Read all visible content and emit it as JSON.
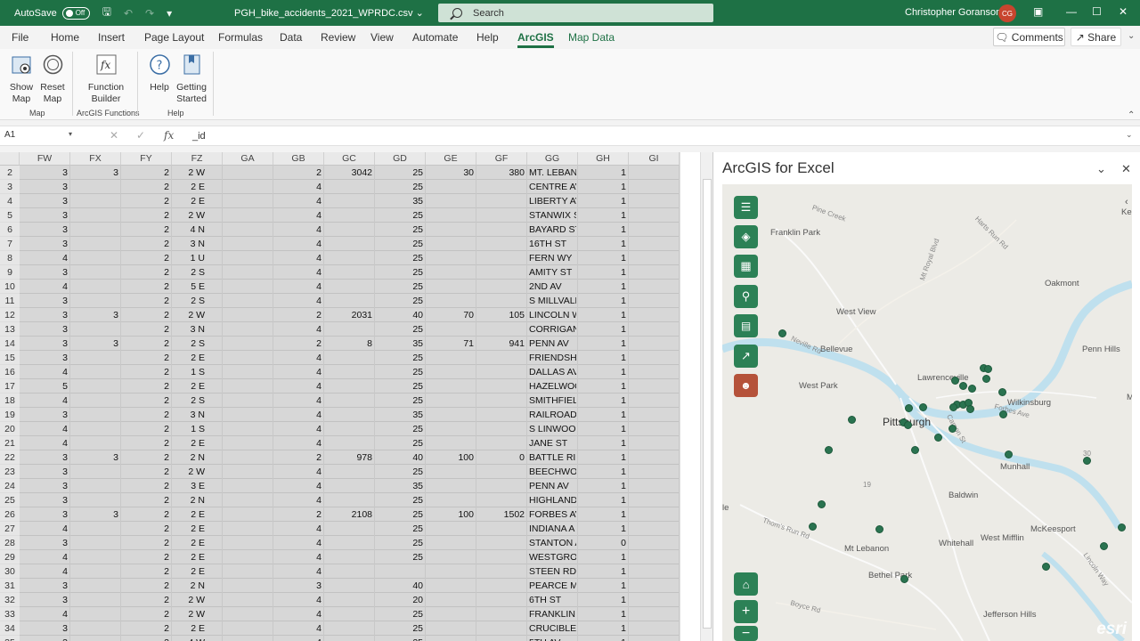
{
  "titlebar": {
    "autosave_label": "AutoSave",
    "autosave_state": "Off",
    "filename": "PGH_bike_accidents_2021_WPRDC.csv",
    "search_placeholder": "Search",
    "user_name": "Christopher Goranson",
    "user_initials": "CG"
  },
  "menu": {
    "tabs": [
      "File",
      "Home",
      "Insert",
      "Page Layout",
      "Formulas",
      "Data",
      "Review",
      "View",
      "Automate",
      "Help",
      "ArcGIS",
      "Map Data"
    ],
    "active_tab": "ArcGIS",
    "comments": "Comments",
    "share": "Share"
  },
  "ribbon": {
    "show_map": [
      "Show",
      "Map"
    ],
    "reset_map": [
      "Reset",
      "Map"
    ],
    "function_builder": [
      "Function",
      "Builder"
    ],
    "help": "Help",
    "getting_started": [
      "Getting",
      "Started"
    ],
    "groups": [
      "Map",
      "ArcGIS Functions",
      "Help"
    ]
  },
  "formula_bar": {
    "name_box": "A1",
    "fx": "fx",
    "value": "_id"
  },
  "sheet": {
    "columns": [
      "FW",
      "FX",
      "FY",
      "FZ",
      "GA",
      "GB",
      "GC",
      "GD",
      "GE",
      "GF",
      "GG",
      "GH",
      "GI"
    ],
    "rows": [
      {
        "n": "2",
        "FW": "3",
        "FX": "3",
        "FY": "2",
        "FZ": "2 W",
        "GB": "2",
        "GC": "3042",
        "GD": "25",
        "GE": "30",
        "GF": "380",
        "GG": "MT. LEBAN",
        "GH": "1"
      },
      {
        "n": "3",
        "FW": "3",
        "FX": "",
        "FY": "2",
        "FZ": "2 E",
        "GB": "4",
        "GC": "",
        "GD": "25",
        "GE": "",
        "GF": "",
        "GG": "CENTRE AV",
        "GH": "1"
      },
      {
        "n": "4",
        "FW": "3",
        "FX": "",
        "FY": "2",
        "FZ": "2 E",
        "GB": "4",
        "GC": "",
        "GD": "35",
        "GE": "",
        "GF": "",
        "GG": "LIBERTY AV",
        "GH": "1"
      },
      {
        "n": "5",
        "FW": "3",
        "FX": "",
        "FY": "2",
        "FZ": "2 W",
        "GB": "4",
        "GC": "",
        "GD": "25",
        "GE": "",
        "GF": "",
        "GG": "STANWIX S",
        "GH": "1"
      },
      {
        "n": "6",
        "FW": "3",
        "FX": "",
        "FY": "2",
        "FZ": "4 N",
        "GB": "4",
        "GC": "",
        "GD": "25",
        "GE": "",
        "GF": "",
        "GG": "BAYARD ST",
        "GH": "1"
      },
      {
        "n": "7",
        "FW": "3",
        "FX": "",
        "FY": "2",
        "FZ": "3 N",
        "GB": "4",
        "GC": "",
        "GD": "25",
        "GE": "",
        "GF": "",
        "GG": "16TH ST",
        "GH": "1"
      },
      {
        "n": "8",
        "FW": "4",
        "FX": "",
        "FY": "2",
        "FZ": "1 U",
        "GB": "4",
        "GC": "",
        "GD": "25",
        "GE": "",
        "GF": "",
        "GG": "FERN WY",
        "GH": "1"
      },
      {
        "n": "9",
        "FW": "3",
        "FX": "",
        "FY": "2",
        "FZ": "2 S",
        "GB": "4",
        "GC": "",
        "GD": "25",
        "GE": "",
        "GF": "",
        "GG": "AMITY ST",
        "GH": "1"
      },
      {
        "n": "10",
        "FW": "4",
        "FX": "",
        "FY": "2",
        "FZ": "5 E",
        "GB": "4",
        "GC": "",
        "GD": "25",
        "GE": "",
        "GF": "",
        "GG": "2ND AV",
        "GH": "1"
      },
      {
        "n": "11",
        "FW": "3",
        "FX": "",
        "FY": "2",
        "FZ": "2 S",
        "GB": "4",
        "GC": "",
        "GD": "25",
        "GE": "",
        "GF": "",
        "GG": "S MILLVALE",
        "GH": "1"
      },
      {
        "n": "12",
        "FW": "3",
        "FX": "3",
        "FY": "2",
        "FZ": "2 W",
        "GB": "2",
        "GC": "2031",
        "GD": "40",
        "GE": "70",
        "GF": "105",
        "GG": "LINCOLN W",
        "GH": "1"
      },
      {
        "n": "13",
        "FW": "3",
        "FX": "",
        "FY": "2",
        "FZ": "3 N",
        "GB": "4",
        "GC": "",
        "GD": "25",
        "GE": "",
        "GF": "",
        "GG": "CORRIGAN",
        "GH": "1"
      },
      {
        "n": "14",
        "FW": "3",
        "FX": "3",
        "FY": "2",
        "FZ": "2 S",
        "GB": "2",
        "GC": "8",
        "GD": "35",
        "GE": "71",
        "GF": "941",
        "GG": "PENN AV",
        "GH": "1"
      },
      {
        "n": "15",
        "FW": "3",
        "FX": "",
        "FY": "2",
        "FZ": "2 E",
        "GB": "4",
        "GC": "",
        "GD": "25",
        "GE": "",
        "GF": "",
        "GG": "FRIENDSHI",
        "GH": "1"
      },
      {
        "n": "16",
        "FW": "4",
        "FX": "",
        "FY": "2",
        "FZ": "1 S",
        "GB": "4",
        "GC": "",
        "GD": "25",
        "GE": "",
        "GF": "",
        "GG": "DALLAS AV",
        "GH": "1"
      },
      {
        "n": "17",
        "FW": "5",
        "FX": "",
        "FY": "2",
        "FZ": "2 E",
        "GB": "4",
        "GC": "",
        "GD": "25",
        "GE": "",
        "GF": "",
        "GG": "HAZELWOO",
        "GH": "1"
      },
      {
        "n": "18",
        "FW": "4",
        "FX": "",
        "FY": "2",
        "FZ": "2 S",
        "GB": "4",
        "GC": "",
        "GD": "25",
        "GE": "",
        "GF": "",
        "GG": "SMITHFIELI",
        "GH": "1"
      },
      {
        "n": "19",
        "FW": "3",
        "FX": "",
        "FY": "2",
        "FZ": "3 N",
        "GB": "4",
        "GC": "",
        "GD": "35",
        "GE": "",
        "GF": "",
        "GG": "RAILROAD",
        "GH": "1"
      },
      {
        "n": "20",
        "FW": "4",
        "FX": "",
        "FY": "2",
        "FZ": "1 S",
        "GB": "4",
        "GC": "",
        "GD": "25",
        "GE": "",
        "GF": "",
        "GG": "S LINWOOI",
        "GH": "1"
      },
      {
        "n": "21",
        "FW": "4",
        "FX": "",
        "FY": "2",
        "FZ": "2 E",
        "GB": "4",
        "GC": "",
        "GD": "25",
        "GE": "",
        "GF": "",
        "GG": "JANE ST",
        "GH": "1"
      },
      {
        "n": "22",
        "FW": "3",
        "FX": "3",
        "FY": "2",
        "FZ": "2 N",
        "GB": "2",
        "GC": "978",
        "GD": "40",
        "GE": "100",
        "GF": "0",
        "GG": "BATTLE RID",
        "GH": "1"
      },
      {
        "n": "23",
        "FW": "3",
        "FX": "",
        "FY": "2",
        "FZ": "2 W",
        "GB": "4",
        "GC": "",
        "GD": "25",
        "GE": "",
        "GF": "",
        "GG": "BEECHWOC",
        "GH": "1"
      },
      {
        "n": "24",
        "FW": "3",
        "FX": "",
        "FY": "2",
        "FZ": "3 E",
        "GB": "4",
        "GC": "",
        "GD": "35",
        "GE": "",
        "GF": "",
        "GG": "PENN AV",
        "GH": "1"
      },
      {
        "n": "25",
        "FW": "3",
        "FX": "",
        "FY": "2",
        "FZ": "2 N",
        "GB": "4",
        "GC": "",
        "GD": "25",
        "GE": "",
        "GF": "",
        "GG": "HIGHLAND",
        "GH": "1"
      },
      {
        "n": "26",
        "FW": "3",
        "FX": "3",
        "FY": "2",
        "FZ": "2 E",
        "GB": "2",
        "GC": "2108",
        "GD": "25",
        "GE": "100",
        "GF": "1502",
        "GG": "FORBES AV",
        "GH": "1"
      },
      {
        "n": "27",
        "FW": "4",
        "FX": "",
        "FY": "2",
        "FZ": "2 E",
        "GB": "4",
        "GC": "",
        "GD": "25",
        "GE": "",
        "GF": "",
        "GG": "INDIANA A",
        "GH": "1"
      },
      {
        "n": "28",
        "FW": "3",
        "FX": "",
        "FY": "2",
        "FZ": "2 E",
        "GB": "4",
        "GC": "",
        "GD": "25",
        "GE": "",
        "GF": "",
        "GG": "STANTON A",
        "GH": "0"
      },
      {
        "n": "29",
        "FW": "4",
        "FX": "",
        "FY": "2",
        "FZ": "2 E",
        "GB": "4",
        "GC": "",
        "GD": "25",
        "GE": "",
        "GF": "",
        "GG": "WESTGROV",
        "GH": "1"
      },
      {
        "n": "30",
        "FW": "4",
        "FX": "",
        "FY": "2",
        "FZ": "2 E",
        "GB": "4",
        "GC": "",
        "GD": "",
        "GE": "",
        "GF": "",
        "GG": "STEEN RD",
        "GH": "1"
      },
      {
        "n": "31",
        "FW": "3",
        "FX": "",
        "FY": "2",
        "FZ": "2 N",
        "GB": "3",
        "GC": "",
        "GD": "40",
        "GE": "",
        "GF": "",
        "GG": "PEARCE MI",
        "GH": "1"
      },
      {
        "n": "32",
        "FW": "3",
        "FX": "",
        "FY": "2",
        "FZ": "2 W",
        "GB": "4",
        "GC": "",
        "GD": "20",
        "GE": "",
        "GF": "",
        "GG": "6TH ST",
        "GH": "1"
      },
      {
        "n": "33",
        "FW": "4",
        "FX": "",
        "FY": "2",
        "FZ": "2 W",
        "GB": "4",
        "GC": "",
        "GD": "25",
        "GE": "",
        "GF": "",
        "GG": "FRANKLIN S",
        "GH": "1"
      },
      {
        "n": "34",
        "FW": "3",
        "FX": "",
        "FY": "2",
        "FZ": "2 E",
        "GB": "4",
        "GC": "",
        "GD": "25",
        "GE": "",
        "GF": "",
        "GG": "CRUCIBLE S",
        "GH": "1"
      },
      {
        "n": "35",
        "FW": "3",
        "FX": "",
        "FY": "2",
        "FZ": "4 W",
        "GB": "4",
        "GC": "",
        "GD": "25",
        "GE": "",
        "GF": "",
        "GG": "5TH AV",
        "GH": "1"
      }
    ]
  },
  "pane": {
    "title": "ArcGIS for Excel",
    "map_labels": [
      {
        "t": "Franklin Park",
        "cls": ""
      },
      {
        "t": "Oakmont",
        "cls": ""
      },
      {
        "t": "West View",
        "cls": ""
      },
      {
        "t": "Bellevue",
        "cls": ""
      },
      {
        "t": "Penn Hills",
        "cls": ""
      },
      {
        "t": "West Park",
        "cls": ""
      },
      {
        "t": "Lawrenceville",
        "cls": ""
      },
      {
        "t": "Wilkinsburg",
        "cls": ""
      },
      {
        "t": "Pittsburgh",
        "cls": "big"
      },
      {
        "t": "Munhall",
        "cls": ""
      },
      {
        "t": "Baldwin",
        "cls": ""
      },
      {
        "t": "McKeesport",
        "cls": ""
      },
      {
        "t": "Whitehall",
        "cls": ""
      },
      {
        "t": "West Mifflin",
        "cls": ""
      },
      {
        "t": "Mt Lebanon",
        "cls": ""
      },
      {
        "t": "Bethel Park",
        "cls": ""
      },
      {
        "t": "Jefferson Hills",
        "cls": ""
      },
      {
        "t": "Mo",
        "cls": ""
      },
      {
        "t": "Ke",
        "cls": ""
      },
      {
        "t": "le",
        "cls": ""
      },
      {
        "t": "Pine Creek",
        "cls": "road"
      },
      {
        "t": "Harts Run Rd",
        "cls": "road"
      },
      {
        "t": "Mt Royal Blvd",
        "cls": "road"
      },
      {
        "t": "Neville Rd",
        "cls": "road"
      },
      {
        "t": "Thom's Run Rd",
        "cls": "road"
      },
      {
        "t": "Boyce Rd",
        "cls": "road"
      },
      {
        "t": "Lincoln Way",
        "cls": "road"
      },
      {
        "t": "Forbes Ave",
        "cls": "road"
      },
      {
        "t": "Carson St",
        "cls": "road"
      },
      {
        "t": "19",
        "cls": "road"
      },
      {
        "t": "30",
        "cls": "road"
      }
    ],
    "esri": "esri"
  }
}
